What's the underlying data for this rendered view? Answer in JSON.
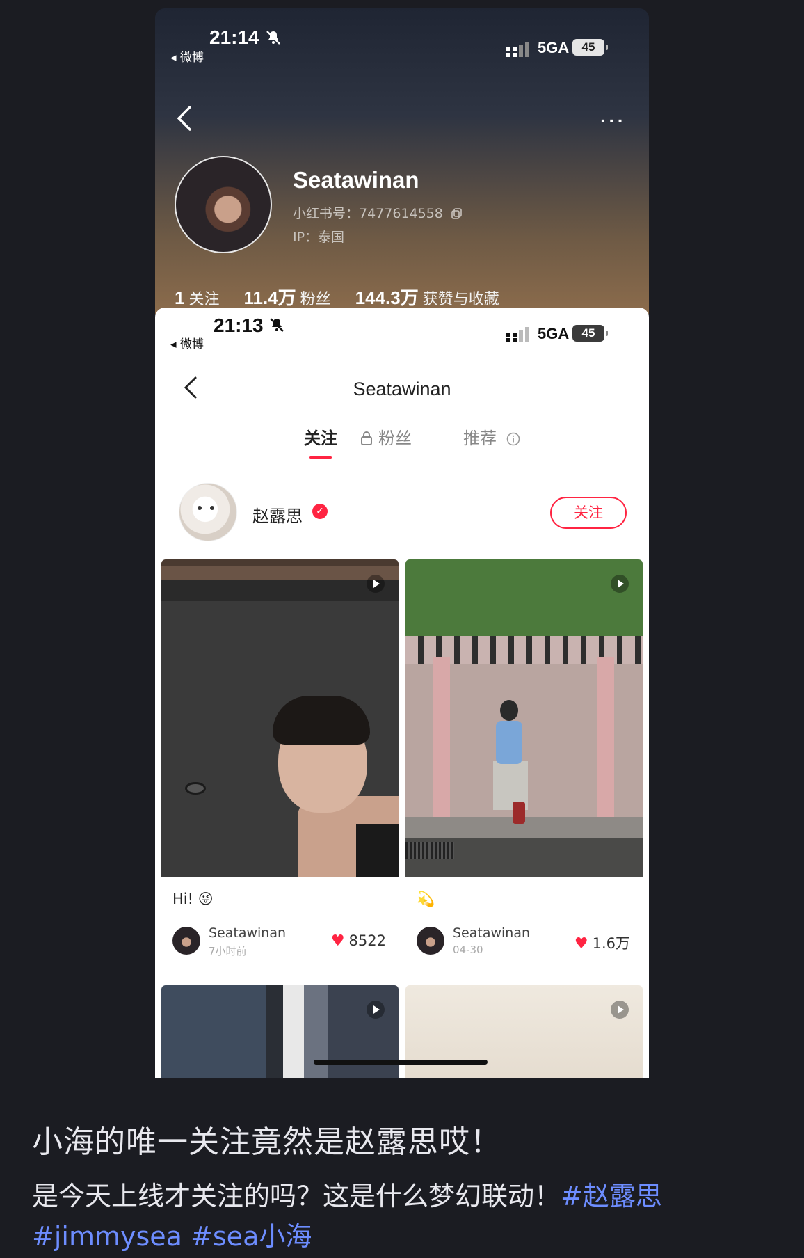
{
  "back_screen": {
    "status": {
      "time": "21:14",
      "source": "◂ 微博",
      "network": "5GA",
      "battery": "45"
    },
    "more_label": "···",
    "profile": {
      "name": "Seatawinan",
      "id_line": "小红书号：7477614558",
      "ip_line": "IP：泰国"
    },
    "stats": [
      {
        "value": "1",
        "label": "关注"
      },
      {
        "value": "11.4万",
        "label": "粉丝"
      },
      {
        "value": "144.3万",
        "label": "获赞与收藏"
      }
    ]
  },
  "front_screen": {
    "status": {
      "time": "21:13",
      "source": "◂ 微博",
      "network": "5GA",
      "battery": "45"
    },
    "nav_title": "Seatawinan",
    "tabs": [
      {
        "label": "关注"
      },
      {
        "label": "粉丝"
      },
      {
        "label": "推荐"
      }
    ],
    "followed_user": {
      "name": "赵露思",
      "verified_mark": "✓",
      "follow_label": "关注"
    },
    "cards": [
      {
        "caption": "Hi! 😜",
        "author": "Seatawinan",
        "time": "7小时前",
        "likes": "8522"
      },
      {
        "caption": "💫",
        "author": "Seatawinan",
        "time": "04-30",
        "likes": "1.6万"
      }
    ],
    "heart_icon": "♥"
  },
  "post": {
    "title": "小海的唯一关注竟然是赵露思哎！",
    "body_text": "是今天上线才关注的吗？这是什么梦幻联动！",
    "tags": [
      "#赵露思",
      "#jimmysea",
      "#sea小海"
    ]
  }
}
